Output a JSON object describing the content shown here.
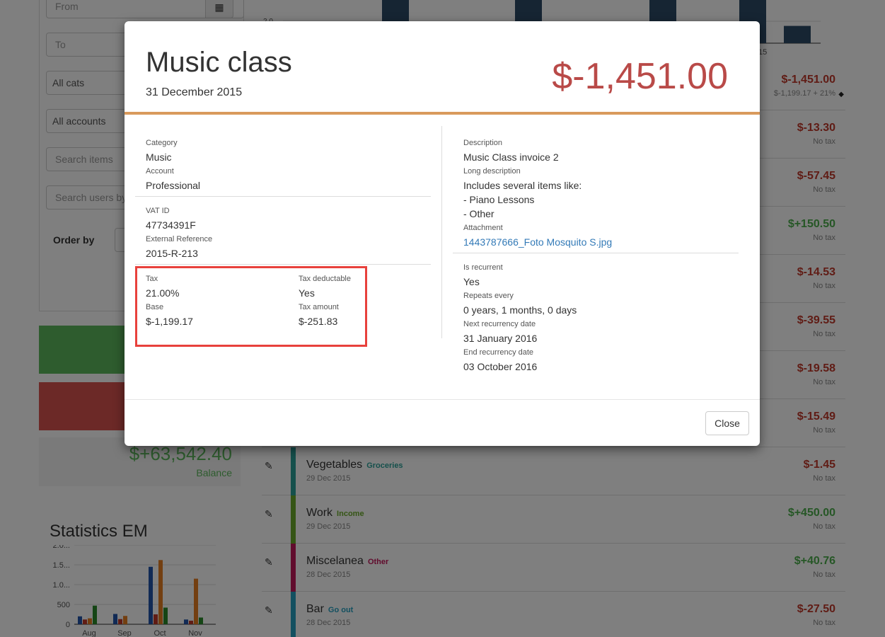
{
  "filters": {
    "from_placeholder": "From",
    "to_placeholder": "To",
    "category": "All cats",
    "account": "All accounts",
    "search_items_placeholder": "Search items",
    "search_users_placeholder": "Search users by",
    "order_by_label": "Order by"
  },
  "balance": {
    "value": "$+63,542.40",
    "label": "Balance"
  },
  "statistics": {
    "title": "Statistics EM",
    "chart_data": {
      "type": "bar",
      "categories": [
        "Aug",
        "Sep",
        "Oct",
        "Nov"
      ],
      "y_ticks": [
        "0",
        "500",
        "1.0...",
        "1.5...",
        "2.0..."
      ],
      "series": [
        {
          "color": "#2255aa",
          "values": [
            200,
            260,
            1450,
            120
          ]
        },
        {
          "color": "#c0392b",
          "values": [
            120,
            130,
            250,
            90
          ]
        },
        {
          "color": "#e67e22",
          "values": [
            150,
            210,
            1620,
            1150
          ]
        },
        {
          "color": "#2a8a2a",
          "values": [
            470,
            0,
            420,
            170
          ]
        }
      ]
    }
  },
  "top_chart": {
    "x_tick": "15",
    "y_tick": "2.0",
    "bars": [
      0.22,
      1.0,
      0.35,
      1.0,
      0.2,
      1.0,
      0.4,
      1.0,
      0.4
    ]
  },
  "partial_rows": [
    {
      "amount": "$-1,451.00",
      "tax": "$-1,199.17 + 21%",
      "sign": "neg",
      "tagged": true
    },
    {
      "amount": "$-13.30",
      "tax": "No tax",
      "sign": "neg"
    },
    {
      "amount": "$-57.45",
      "tax": "No tax",
      "sign": "neg"
    },
    {
      "amount": "$+150.50",
      "tax": "No tax",
      "sign": "pos"
    },
    {
      "amount": "$-14.53",
      "tax": "No tax",
      "sign": "neg"
    },
    {
      "amount": "$-39.55",
      "tax": "No tax",
      "sign": "neg"
    },
    {
      "amount": "$-19.58",
      "tax": "No tax",
      "sign": "neg"
    },
    {
      "amount": "$-15.49",
      "tax": "No tax",
      "sign": "neg"
    }
  ],
  "transactions": [
    {
      "name": "Vegetables",
      "category": "Groceries",
      "cat_color": "#2aa198",
      "bar_color": "#2aa198",
      "date": "29 Dec 2015",
      "amount": "$-1.45",
      "sign": "neg",
      "tax": "No tax"
    },
    {
      "name": "Work",
      "category": "Income",
      "cat_color": "#6aaa2a",
      "bar_color": "#6aaa2a",
      "date": "29 Dec 2015",
      "amount": "$+450.00",
      "sign": "pos",
      "tax": "No tax"
    },
    {
      "name": "Miscelanea",
      "category": "Other",
      "cat_color": "#c2185b",
      "bar_color": "#c2185b",
      "date": "28 Dec 2015",
      "amount": "$+40.76",
      "sign": "pos",
      "tax": "No tax"
    },
    {
      "name": "Bar",
      "category": "Go out",
      "cat_color": "#26a0c0",
      "bar_color": "#26a0c0",
      "date": "28 Dec 2015",
      "amount": "$-27.50",
      "sign": "neg",
      "tax": "No tax"
    }
  ],
  "modal": {
    "title": "Music class",
    "date": "31 December 2015",
    "total": "$-1,451.00",
    "left": {
      "category_label": "Category",
      "category": "Music",
      "account_label": "Account",
      "account": "Professional",
      "vat_label": "VAT ID",
      "vat": "47734391F",
      "extref_label": "External Reference",
      "extref": "2015-R-213",
      "tax_label": "Tax",
      "tax": "21.00%",
      "deductable_label": "Tax deductable",
      "deductable": "Yes",
      "base_label": "Base",
      "base": "$-1,199.17",
      "taxamount_label": "Tax amount",
      "taxamount": "$-251.83"
    },
    "right": {
      "description_label": "Description",
      "description": "Music Class invoice 2",
      "longdesc_label": "Long description",
      "longdesc_lines": [
        "Includes several items like:",
        "- Piano Lessons",
        "- Other"
      ],
      "attachment_label": "Attachment",
      "attachment": "1443787666_Foto Mosquito S.jpg",
      "recurrent_label": "Is recurrent",
      "recurrent": "Yes",
      "repeats_label": "Repeats every",
      "repeats": "0 years, 1 months, 0 days",
      "next_label": "Next recurrency date",
      "next": "31 January 2016",
      "end_label": "End recurrency date",
      "end": "03 October 2016"
    },
    "close_label": "Close"
  }
}
